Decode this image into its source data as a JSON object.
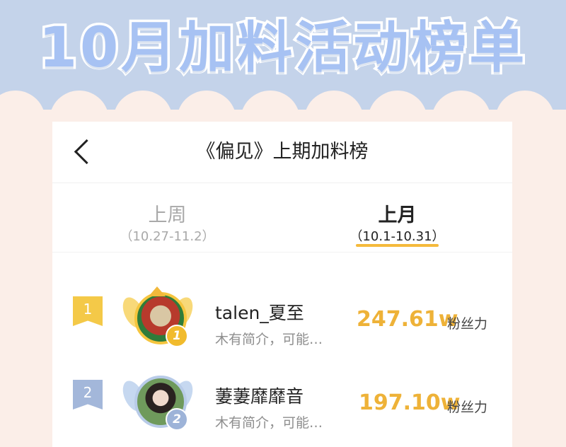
{
  "banner": {
    "title": "10月加料活动榜单"
  },
  "header": {
    "title": "《偏见》上期加料榜"
  },
  "tabs": [
    {
      "label": "上周",
      "range": "（10.27-11.2）",
      "active": false
    },
    {
      "label": "上月",
      "range": "（10.1-10.31）",
      "active": true
    }
  ],
  "ranking": [
    {
      "rank": "1",
      "name": "talen_夏至",
      "bio": "木有简介，可能…",
      "fans": "247.61w",
      "fans_label": "粉丝力"
    },
    {
      "rank": "2",
      "name": "萋萋靡靡音",
      "bio": "木有简介，可能…",
      "fans": "197.10w",
      "fans_label": "粉丝力"
    }
  ],
  "colors": {
    "banner_bg": "#c4d3ea",
    "page_bg": "#fbeee8",
    "accent": "#f5ba3c",
    "fans_number": "#eeb238",
    "gold_rank": "#f4c948",
    "silver_rank": "#a3b7da"
  }
}
